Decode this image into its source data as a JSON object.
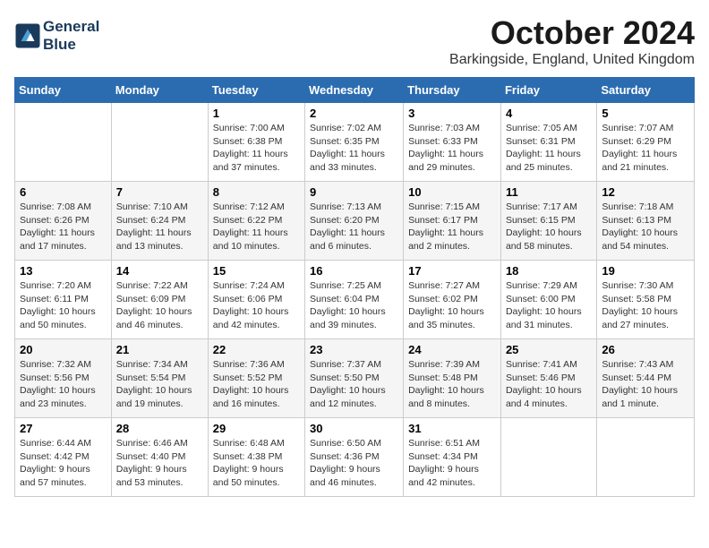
{
  "header": {
    "logo_line1": "General",
    "logo_line2": "Blue",
    "month_title": "October 2024",
    "location": "Barkingside, England, United Kingdom"
  },
  "days_of_week": [
    "Sunday",
    "Monday",
    "Tuesday",
    "Wednesday",
    "Thursday",
    "Friday",
    "Saturday"
  ],
  "weeks": [
    [
      {
        "num": "",
        "sunrise": "",
        "sunset": "",
        "daylight": ""
      },
      {
        "num": "",
        "sunrise": "",
        "sunset": "",
        "daylight": ""
      },
      {
        "num": "1",
        "sunrise": "Sunrise: 7:00 AM",
        "sunset": "Sunset: 6:38 PM",
        "daylight": "Daylight: 11 hours and 37 minutes."
      },
      {
        "num": "2",
        "sunrise": "Sunrise: 7:02 AM",
        "sunset": "Sunset: 6:35 PM",
        "daylight": "Daylight: 11 hours and 33 minutes."
      },
      {
        "num": "3",
        "sunrise": "Sunrise: 7:03 AM",
        "sunset": "Sunset: 6:33 PM",
        "daylight": "Daylight: 11 hours and 29 minutes."
      },
      {
        "num": "4",
        "sunrise": "Sunrise: 7:05 AM",
        "sunset": "Sunset: 6:31 PM",
        "daylight": "Daylight: 11 hours and 25 minutes."
      },
      {
        "num": "5",
        "sunrise": "Sunrise: 7:07 AM",
        "sunset": "Sunset: 6:29 PM",
        "daylight": "Daylight: 11 hours and 21 minutes."
      }
    ],
    [
      {
        "num": "6",
        "sunrise": "Sunrise: 7:08 AM",
        "sunset": "Sunset: 6:26 PM",
        "daylight": "Daylight: 11 hours and 17 minutes."
      },
      {
        "num": "7",
        "sunrise": "Sunrise: 7:10 AM",
        "sunset": "Sunset: 6:24 PM",
        "daylight": "Daylight: 11 hours and 13 minutes."
      },
      {
        "num": "8",
        "sunrise": "Sunrise: 7:12 AM",
        "sunset": "Sunset: 6:22 PM",
        "daylight": "Daylight: 11 hours and 10 minutes."
      },
      {
        "num": "9",
        "sunrise": "Sunrise: 7:13 AM",
        "sunset": "Sunset: 6:20 PM",
        "daylight": "Daylight: 11 hours and 6 minutes."
      },
      {
        "num": "10",
        "sunrise": "Sunrise: 7:15 AM",
        "sunset": "Sunset: 6:17 PM",
        "daylight": "Daylight: 11 hours and 2 minutes."
      },
      {
        "num": "11",
        "sunrise": "Sunrise: 7:17 AM",
        "sunset": "Sunset: 6:15 PM",
        "daylight": "Daylight: 10 hours and 58 minutes."
      },
      {
        "num": "12",
        "sunrise": "Sunrise: 7:18 AM",
        "sunset": "Sunset: 6:13 PM",
        "daylight": "Daylight: 10 hours and 54 minutes."
      }
    ],
    [
      {
        "num": "13",
        "sunrise": "Sunrise: 7:20 AM",
        "sunset": "Sunset: 6:11 PM",
        "daylight": "Daylight: 10 hours and 50 minutes."
      },
      {
        "num": "14",
        "sunrise": "Sunrise: 7:22 AM",
        "sunset": "Sunset: 6:09 PM",
        "daylight": "Daylight: 10 hours and 46 minutes."
      },
      {
        "num": "15",
        "sunrise": "Sunrise: 7:24 AM",
        "sunset": "Sunset: 6:06 PM",
        "daylight": "Daylight: 10 hours and 42 minutes."
      },
      {
        "num": "16",
        "sunrise": "Sunrise: 7:25 AM",
        "sunset": "Sunset: 6:04 PM",
        "daylight": "Daylight: 10 hours and 39 minutes."
      },
      {
        "num": "17",
        "sunrise": "Sunrise: 7:27 AM",
        "sunset": "Sunset: 6:02 PM",
        "daylight": "Daylight: 10 hours and 35 minutes."
      },
      {
        "num": "18",
        "sunrise": "Sunrise: 7:29 AM",
        "sunset": "Sunset: 6:00 PM",
        "daylight": "Daylight: 10 hours and 31 minutes."
      },
      {
        "num": "19",
        "sunrise": "Sunrise: 7:30 AM",
        "sunset": "Sunset: 5:58 PM",
        "daylight": "Daylight: 10 hours and 27 minutes."
      }
    ],
    [
      {
        "num": "20",
        "sunrise": "Sunrise: 7:32 AM",
        "sunset": "Sunset: 5:56 PM",
        "daylight": "Daylight: 10 hours and 23 minutes."
      },
      {
        "num": "21",
        "sunrise": "Sunrise: 7:34 AM",
        "sunset": "Sunset: 5:54 PM",
        "daylight": "Daylight: 10 hours and 19 minutes."
      },
      {
        "num": "22",
        "sunrise": "Sunrise: 7:36 AM",
        "sunset": "Sunset: 5:52 PM",
        "daylight": "Daylight: 10 hours and 16 minutes."
      },
      {
        "num": "23",
        "sunrise": "Sunrise: 7:37 AM",
        "sunset": "Sunset: 5:50 PM",
        "daylight": "Daylight: 10 hours and 12 minutes."
      },
      {
        "num": "24",
        "sunrise": "Sunrise: 7:39 AM",
        "sunset": "Sunset: 5:48 PM",
        "daylight": "Daylight: 10 hours and 8 minutes."
      },
      {
        "num": "25",
        "sunrise": "Sunrise: 7:41 AM",
        "sunset": "Sunset: 5:46 PM",
        "daylight": "Daylight: 10 hours and 4 minutes."
      },
      {
        "num": "26",
        "sunrise": "Sunrise: 7:43 AM",
        "sunset": "Sunset: 5:44 PM",
        "daylight": "Daylight: 10 hours and 1 minute."
      }
    ],
    [
      {
        "num": "27",
        "sunrise": "Sunrise: 6:44 AM",
        "sunset": "Sunset: 4:42 PM",
        "daylight": "Daylight: 9 hours and 57 minutes."
      },
      {
        "num": "28",
        "sunrise": "Sunrise: 6:46 AM",
        "sunset": "Sunset: 4:40 PM",
        "daylight": "Daylight: 9 hours and 53 minutes."
      },
      {
        "num": "29",
        "sunrise": "Sunrise: 6:48 AM",
        "sunset": "Sunset: 4:38 PM",
        "daylight": "Daylight: 9 hours and 50 minutes."
      },
      {
        "num": "30",
        "sunrise": "Sunrise: 6:50 AM",
        "sunset": "Sunset: 4:36 PM",
        "daylight": "Daylight: 9 hours and 46 minutes."
      },
      {
        "num": "31",
        "sunrise": "Sunrise: 6:51 AM",
        "sunset": "Sunset: 4:34 PM",
        "daylight": "Daylight: 9 hours and 42 minutes."
      },
      {
        "num": "",
        "sunrise": "",
        "sunset": "",
        "daylight": ""
      },
      {
        "num": "",
        "sunrise": "",
        "sunset": "",
        "daylight": ""
      }
    ]
  ]
}
